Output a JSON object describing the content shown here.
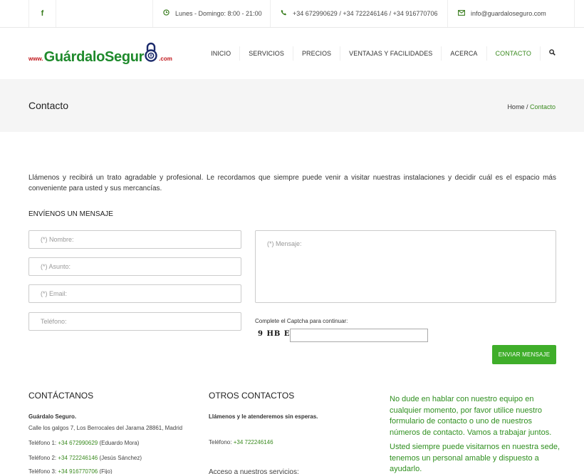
{
  "topbar": {
    "facebook_icon": "f",
    "hours": "Lunes - Domingo: 8:00 - 21:00",
    "phones": "+34 672990629 / +34 722246146 / +34 916770706",
    "email": "info@guardaloseguro.com"
  },
  "logo": {
    "prefix": "www.",
    "brand": "GuárdaloSegur",
    "suffix": ".com"
  },
  "nav": {
    "items": [
      "INICIO",
      "SERVICIOS",
      "PRECIOS",
      "VENTAJAS Y FACILIDADES",
      "ACERCA",
      "CONTACTO"
    ],
    "active": "CONTACTO"
  },
  "page": {
    "title": "Contacto",
    "breadcrumb": {
      "home": "Home",
      "sep": " / ",
      "current": "Contacto"
    }
  },
  "intro": "Llámenos y recibirá un trato agradable y profesional. Le recordamos que siempre puede venir a visitar nuestras instalaciones y decidir cuál es el espacio más conveniente para usted y sus mercancías.",
  "form": {
    "title": "ENVÍENOS UN MENSAJE",
    "name_placeholder": "(*) Nombre:",
    "subject_placeholder": "(*) Asunto:",
    "email_placeholder": "(*) Email:",
    "phone_placeholder": "Teléfono:",
    "message_placeholder": "(*) Mensaje:",
    "captcha_label": "Complete el Captcha para continuar:",
    "captcha_code": "9 HB E",
    "send_label": "ENVIAR MENSAJE"
  },
  "contact": {
    "title": "CONTÁCTANOS",
    "company": "Guárdalo Seguro.",
    "address": "Calle los galgos 7, Los Berrocales del Jarama 28861, Madrid",
    "phones": [
      {
        "label": "Teléfono 1: ",
        "number": "+34 672990629",
        "who": " (Eduardo Mora)"
      },
      {
        "label": "Teléfono 2: ",
        "number": "+34 722246146",
        "who": " (Jesús Sánchez)"
      },
      {
        "label": "Teléfono 3: ",
        "number": "+34 916770706",
        "who": " (Fijo)"
      }
    ]
  },
  "other": {
    "title": "OTROS CONTACTOS",
    "call_text": "Llámenos y le atenderemos sin esperas.",
    "phone_label": "Teléfono: ",
    "phone": "+34 722246146",
    "access": "Acceso a nuestros servicios:"
  },
  "aside": {
    "p1": "No dude en hablar con nuestro equipo en cualquier momento, por favor utilice nuestro formulario de contacto o uno de nuestros números de contacto. Vamos a trabajar juntos.",
    "p2": "Usted siempre puede visitarnos en nuestra sede, tenemos un personal amable y dispuesto a ayudarlo."
  },
  "colors": {
    "accent": "#3a8a1f",
    "button": "#3fae2a",
    "logo_red": "#c0161b",
    "logo_blue": "#1b2a6b"
  }
}
